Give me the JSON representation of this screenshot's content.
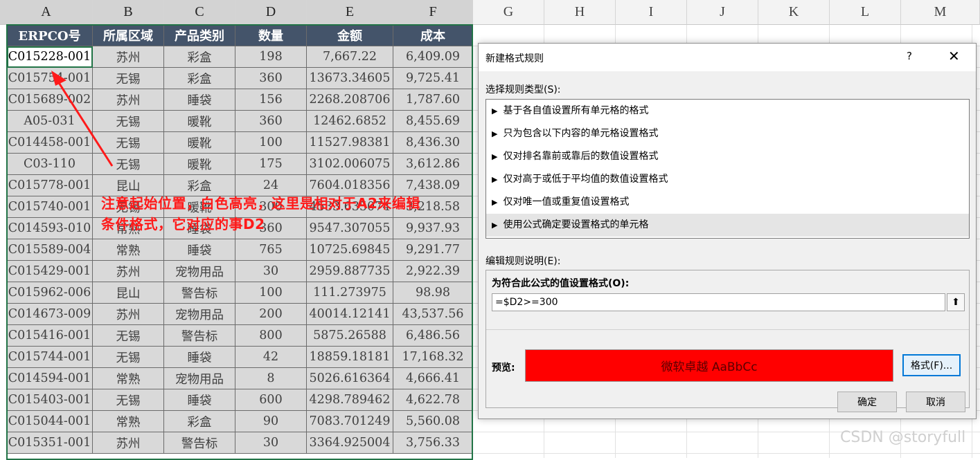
{
  "columns": [
    "A",
    "B",
    "C",
    "D",
    "E",
    "F",
    "G",
    "H",
    "I",
    "J",
    "K",
    "L",
    "M"
  ],
  "table": {
    "headers": [
      "ERPCO号",
      "所属区域",
      "产品类别",
      "数量",
      "金额",
      "成本"
    ],
    "rows": [
      [
        "C015228-001",
        "苏州",
        "彩盒",
        "198",
        "7,667.22",
        "6,409.09"
      ],
      [
        "C015754-001",
        "无锡",
        "彩盒",
        "360",
        "13673.34605",
        "9,725.41"
      ],
      [
        "C015689-002",
        "苏州",
        "睡袋",
        "156",
        "2268.208706",
        "1,787.60"
      ],
      [
        "A05-031",
        "无锡",
        "暖靴",
        "360",
        "12462.6852",
        "8,455.69"
      ],
      [
        "C014458-001",
        "无锡",
        "暖靴",
        "100",
        "11527.98381",
        "8,436.30"
      ],
      [
        "C03-110",
        "无锡",
        "暖靴",
        "175",
        "3102.006075",
        "3,612.86"
      ],
      [
        "C015778-001",
        "昆山",
        "彩盒",
        "24",
        "7604.018356",
        "7,438.09"
      ],
      [
        "C015740-001",
        "无锡",
        "暖靴",
        "300",
        "4533.635074",
        "3,218.58"
      ],
      [
        "C014593-010",
        "常熟",
        "睡袋",
        "360",
        "9547.307055",
        "9,937.93"
      ],
      [
        "C015589-004",
        "常熟",
        "睡袋",
        "765",
        "10725.69845",
        "9,291.77"
      ],
      [
        "C015429-001",
        "苏州",
        "宠物用品",
        "30",
        "2959.887735",
        "2,922.39"
      ],
      [
        "C015962-006",
        "昆山",
        "警告标",
        "100",
        "111.273975",
        "98.98"
      ],
      [
        "C014673-009",
        "苏州",
        "宠物用品",
        "200",
        "40014.12141",
        "43,537.56"
      ],
      [
        "C015416-001",
        "无锡",
        "警告标",
        "800",
        "5875.26588",
        "6,486.56"
      ],
      [
        "C015744-001",
        "无锡",
        "睡袋",
        "42",
        "18859.18181",
        "17,168.32"
      ],
      [
        "C014594-001",
        "常熟",
        "宠物用品",
        "8",
        "5026.616364",
        "4,666.41"
      ],
      [
        "C015403-001",
        "无锡",
        "睡袋",
        "600",
        "4298.789462",
        "4,622.78"
      ],
      [
        "C015044-001",
        "常熟",
        "彩盒",
        "90",
        "7083.701249",
        "5,560.08"
      ],
      [
        "C015351-001",
        "苏州",
        "警告标",
        "30",
        "3364.925004",
        "3,756.33"
      ]
    ]
  },
  "annotation": {
    "line1": "注意起始位置，白色高亮，这里是相对于A2来编辑",
    "line2": "条件格式，它对应的事D2"
  },
  "dialog": {
    "title": "新建格式规则",
    "help": "?",
    "close": "✕",
    "rule_type_label": "选择规则类型(S):",
    "rule_types": [
      "基于各自值设置所有单元格的格式",
      "只为包含以下内容的单元格设置格式",
      "仅对排名靠前或靠后的数值设置格式",
      "仅对高于或低于平均值的数值设置格式",
      "仅对唯一值或重复值设置格式",
      "使用公式确定要设置格式的单元格"
    ],
    "selected_rule_index": 5,
    "desc_label": "编辑规则说明(E):",
    "formula_label": "为符合此公式的值设置格式(O):",
    "formula_value": "=$D2>=300",
    "collapse_icon": "⬆",
    "preview_label": "预览:",
    "preview_text": "微软卓越  AaBbCc",
    "preview_fill": "#ff0000",
    "format_button": "格式(F)...",
    "ok_button": "确定",
    "cancel_button": "取消"
  },
  "watermark": "CSDN @storyfull"
}
